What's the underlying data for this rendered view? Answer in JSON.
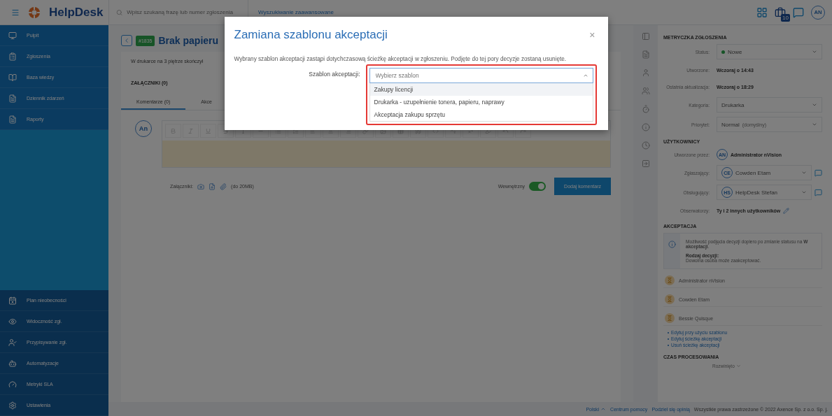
{
  "topbar": {
    "app_name": "HelpDesk",
    "search": {
      "placeholder": "Wpisz szukaną frazę lub numer zgłoszenia"
    },
    "advanced_search": "Wyszukiwanie zaawansowane",
    "notification_count": "10",
    "user_initials": "AN"
  },
  "sidebar": {
    "top_items": [
      "Pulpit",
      "Zgłoszenia",
      "Baza wiedzy",
      "Dziennik zdarzeń",
      "Raporty"
    ],
    "bottom_items": [
      "Plan nieobecności",
      "Widoczność zgł.",
      "Przypisywanie zgł.",
      "Automatyzacje",
      "Metryki SLA",
      "Ustawienia"
    ]
  },
  "ticket": {
    "number": "#1835",
    "title": "Brak papieru",
    "description": "W drukarce na 3 piętrze skończył",
    "attachments_heading": "ZAŁĄCZNIKI (0)",
    "tabs": [
      {
        "label": "Komentarze (0)",
        "selected": true
      },
      {
        "label": "Akce",
        "selected": false
      }
    ],
    "comment": {
      "author_initials": "An",
      "attachments_label": "Załączniki:",
      "attachments_limit": "(do 20MB)",
      "internal_label": "Wewnętrzny",
      "internal": true,
      "submit": "Dodaj komentarz"
    }
  },
  "details": {
    "heading": "METRYCZKA ZGŁOSZENIA",
    "fields": [
      {
        "label": "Status:",
        "value": "Nowe",
        "kind": "status"
      },
      {
        "label": "Utworzone:",
        "value": "Wczoraj o 14:43",
        "kind": "text"
      },
      {
        "label": "Ostatnia aktualizacja:",
        "value": "Wczoraj o 18:29",
        "kind": "text"
      },
      {
        "label": "Kategoria:",
        "value": "Drukarka",
        "kind": "select"
      },
      {
        "label": "Priorytet:",
        "value": "Normal",
        "note": "(domyślny)",
        "kind": "select"
      }
    ],
    "users_heading": "UŻYTKOWNICY",
    "users": [
      {
        "label": "Utworzone przez:",
        "initials": "AN",
        "name": "Administrator nVision",
        "kind": "text"
      },
      {
        "label": "Zgłaszający:",
        "initials": "CE",
        "name": "Cowden Etam",
        "kind": "select"
      },
      {
        "label": "Obsługujący:",
        "initials": "HS",
        "name": "HelpDesk Stefan",
        "kind": "select"
      }
    ],
    "observers_label": "Obserwatorzy:",
    "observers": "Ty i 2 innych użytkowników",
    "acceptance_heading": "AKCEPTACJA",
    "acceptance_info": "Możliwość podjęcia decyzji dopiero po zmianie statusu na **W akceptacji**.",
    "decision_label": "Rodzaj decyzji:",
    "decision_text": "Dowolna osoba może zaakceptować.",
    "approvers": [
      "Administrator nVision",
      "Cowden Etam",
      "Bessie Quisque"
    ],
    "links": [
      "Edytuj przy użyciu szablonu",
      "Edytuj ścieżkę akceptacji",
      "Usuń ścieżkę akceptacji"
    ],
    "processing_heading": "CZAS PROCESOWANIA",
    "processing_toggle": "Rozwinięto"
  },
  "footer": {
    "language": "Polski",
    "links": [
      "Centrum pomocy",
      "Podziel się opinią"
    ],
    "copyright": "Wszystkie prawa zastrzeżone © 2022 Axence Sp. z o.o. Sp. j."
  },
  "modal": {
    "title": "Zamiana szablonu akceptacji",
    "close": "×",
    "message": "Wybrany szablon akceptacji zastąpi dotychczasową ścieżkę akceptacji w zgłoszeniu. Podjęte do tej pory decyzje zostaną usunięte.",
    "field_label": "Szablon akceptacji:",
    "placeholder": "Wybierz szablon",
    "expanded": true,
    "highlighted": true,
    "options": [
      {
        "label": "Zakupy licencji",
        "selected": true
      },
      {
        "label": "Drukarka - uzupełnienie tonera, papieru, naprawy",
        "selected": false
      },
      {
        "label": "Akceptacja zakupu sprzętu",
        "selected": false
      }
    ]
  }
}
